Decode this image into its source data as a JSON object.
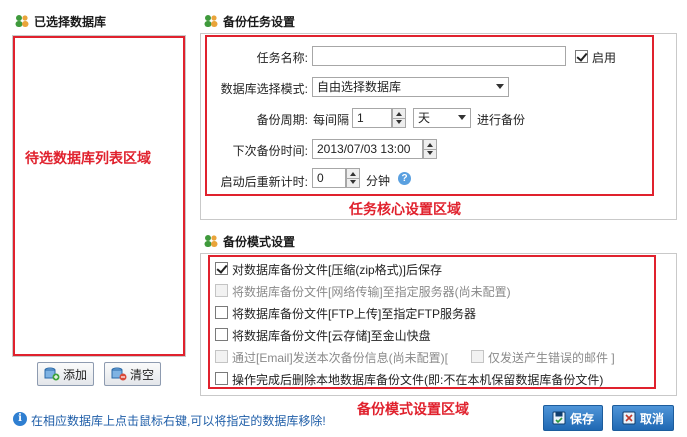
{
  "left": {
    "title": "已选择数据库",
    "area_label": "待选数据库列表区域",
    "add_label": "添加",
    "clear_label": "清空"
  },
  "task": {
    "title": "备份任务设置",
    "name_label": "任务名称:",
    "name_value": "",
    "enable_label": "启用",
    "enabled": true,
    "mode_label": "数据库选择模式:",
    "mode_value": "自由选择数据库",
    "period_label": "备份周期:",
    "every_label": "每间隔",
    "period_value": "1",
    "unit_value": "天",
    "period_suffix": "进行备份",
    "next_label": "下次备份时间:",
    "next_value": "2013/07/03 13:00",
    "restart_label": "启动后重新计时:",
    "restart_value": "0",
    "restart_unit": "分钟",
    "area_label": "任务核心设置区域"
  },
  "mode": {
    "title": "备份模式设置",
    "options": [
      {
        "label": "对数据库备份文件[压缩(zip格式)]后保存",
        "checked": true,
        "disabled": false
      },
      {
        "label": "将数据库备份文件[网络传输]至指定服务器(尚未配置)",
        "checked": false,
        "disabled": true
      },
      {
        "label": "将数据库备份文件[FTP上传]至指定FTP服务器",
        "checked": false,
        "disabled": false
      },
      {
        "label": "将数据库备份文件[云存储]至金山快盘",
        "checked": false,
        "disabled": false
      },
      {
        "label": "通过[Email]发送本次备份信息(尚未配置)[",
        "checked": false,
        "disabled": true
      },
      {
        "label": "操作完成后删除本地数据库备份文件(即:不在本机保留数据库备份文件)",
        "checked": false,
        "disabled": false
      }
    ],
    "email_sub_label": "仅发送产生错误的邮件 ]",
    "area_label": "备份模式设置区域"
  },
  "footer": {
    "hint": "在相应数据库上点击鼠标右键,可以将指定的数据库移除!",
    "save_label": "保存",
    "cancel_label": "取消"
  },
  "icons": {
    "section": "database-users-icon",
    "add": "add-database-icon",
    "clear": "clear-database-icon",
    "help": "help-icon",
    "info": "info-icon",
    "save": "save-icon",
    "cancel": "cancel-icon"
  },
  "colors": {
    "annotation": "#e0212d",
    "primary_button": "#2a74c0",
    "hint_text": "#1f5ea8"
  }
}
